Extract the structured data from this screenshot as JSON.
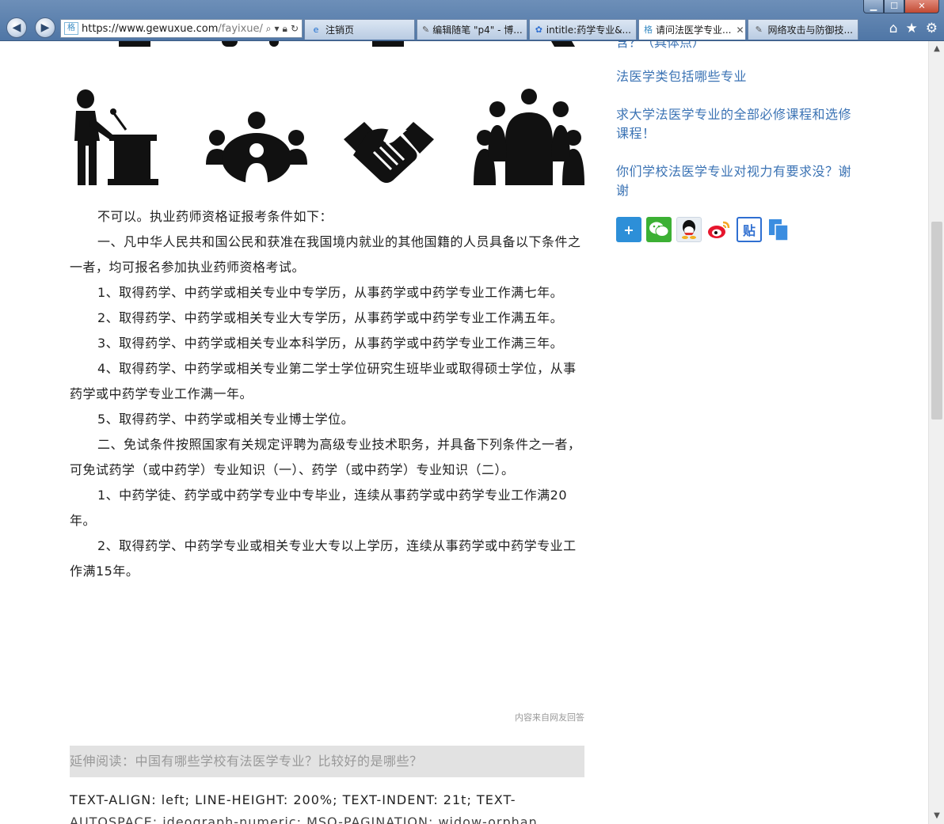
{
  "browser": {
    "url_host": "https://www.gewuxue.com",
    "url_path": "/fayixue/fa",
    "tabs": [
      {
        "label": "注销页",
        "icon": "e"
      },
      {
        "label": "编辑随笔 \"p4\" - 博...",
        "icon": "a"
      },
      {
        "label": "intitle:药学专业&...",
        "icon": "paw"
      },
      {
        "label": "请问法医学专业...",
        "icon": "格",
        "active": true
      },
      {
        "label": "网络攻击与防御技...",
        "icon": "a"
      }
    ],
    "address_favicon": "格",
    "window": {
      "minimize": "▁",
      "maximize": "☐",
      "close": "✕"
    },
    "toolbar": {
      "home": "⌂",
      "favorites": "★",
      "tools": "⚙"
    }
  },
  "article": {
    "paragraphs": [
      "不可以。执业药师资格证报考条件如下：",
      "一、凡中华人民共和国公民和获准在我国境内就业的其他国籍的人员具备以下条件之一者，均可报名参加执业药师资格考试。",
      "1、取得药学、中药学或相关专业中专学历，从事药学或中药学专业工作满七年。",
      "2、取得药学、中药学或相关专业大专学历，从事药学或中药学专业工作满五年。",
      "3、取得药学、中药学或相关专业本科学历，从事药学或中药学专业工作满三年。",
      "4、取得药学、中药学或相关专业第二学士学位研究生班毕业或取得硕士学位，从事药学或中药学专业工作满一年。",
      "5、取得药学、中药学或相关专业博士学位。",
      "二、免试条件按照国家有关规定评聘为高级专业技术职务，并具备下列条件之一者，可免试药学（或中药学）专业知识（一）、药学（或中药学）专业知识（二）。",
      "1、中药学徒、药学或中药学专业中专毕业，连续从事药学或中药学专业工作满20年。",
      "2、取得药学、中药学专业或相关专业大专以上学历，连续从事药学或中药学专业工作满15年。"
    ],
    "source_note": "内容来自网友回答",
    "extended_reading": "延伸阅读：中国有哪些学校有法医学专业？比较好的是哪些？",
    "css_dump_line1": "TEXT-ALIGN: left; LINE-HEIGHT: 200%; TEXT-INDENT: 21t; TEXT-",
    "css_dump_line2": "AUTOSPACE: ideograph-numeric; MSO-PAGINATION: widow-orphan"
  },
  "sidebar": {
    "cut_text": "含？（具体点）",
    "links": [
      "法医学类包括哪些专业",
      "求大学法医学专业的全部必修课程和选修课程！",
      "你们学校法医学专业对视力有要求没？谢谢"
    ]
  },
  "share": [
    {
      "name": "more",
      "glyph": "+",
      "color": "#2d8fd8"
    },
    {
      "name": "wechat",
      "glyph": "●",
      "color": "#3cb034"
    },
    {
      "name": "qq",
      "glyph": "◉",
      "color": "#f5f5f5"
    },
    {
      "name": "weibo",
      "glyph": "◎",
      "color": "#ffffff"
    },
    {
      "name": "tieba",
      "glyph": "贴",
      "color": "#2f6fd1"
    },
    {
      "name": "copy",
      "glyph": "❐",
      "color": "#3b8de0"
    }
  ],
  "scrollbar": {
    "up": "▲",
    "down": "▼"
  }
}
